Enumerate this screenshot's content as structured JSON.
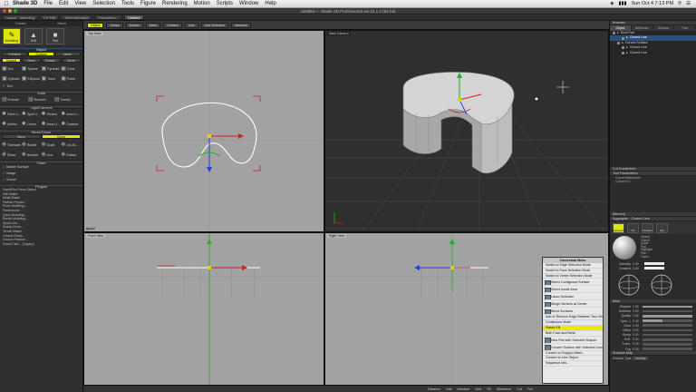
{
  "menubar": {
    "app": "Shade 3D",
    "items": [
      "File",
      "Edit",
      "View",
      "Selection",
      "Tools",
      "Figure",
      "Rendering",
      "Motion",
      "Scripts",
      "Window",
      "Help"
    ],
    "clock": "Sun Oct 4  7:13 PM"
  },
  "window": {
    "title": "Untitled — Shade 3D Professional ver.15.1.2 (64-bit)"
  },
  "doc_tabs": [
    "Layout - Modeling",
    "UV Edit",
    "Shot Animation",
    "Parametric...",
    "Untitled"
  ],
  "left_panel": {
    "tabs": [
      "Create",
      "Mesh"
    ],
    "tools": [
      {
        "label": "Modeling",
        "icon": "modeling-icon"
      },
      {
        "label": "Edit",
        "icon": "edit-icon"
      },
      {
        "label": "Part",
        "icon": "part-icon"
      }
    ],
    "object_header": "Object",
    "mode_buttons": [
      "Primitive",
      "Surface",
      "Mesh"
    ],
    "sub_buttons": [
      "Closed",
      "Open",
      "Rotati...",
      "Circle"
    ],
    "shape_rows": [
      [
        "Box",
        "Sphere",
        "Pyramid",
        "Cone"
      ],
      [
        "Cylinder",
        "Ellipsoid",
        "Torus",
        "Plane"
      ]
    ],
    "text_label": "Text",
    "solid_header": "Solid",
    "solid_buttons": [
      "Extrude",
      "Revolve",
      "Sweep"
    ],
    "light_header": "Light/Camera",
    "light_rows": [
      [
        "Point Li...",
        "Spot Li...",
        "Distant",
        "Area Li..."
      ],
      [
        "Ambie...",
        "Linear",
        "Area Li...",
        "Camera"
      ]
    ],
    "move_header": "Move/Clone",
    "move_buttons": [
      "Move",
      "Clone"
    ],
    "transform_rows": [
      [
        "Translate",
        "Rotate",
        "Scale",
        "Uni-Sc..."
      ],
      [
        "Shear",
        "Number",
        "Line",
        "Flatten"
      ]
    ],
    "other_header": "Other",
    "other_items": [
      "Master Surface",
      "Image",
      "Sound"
    ],
    "plugins_header": "Plugins",
    "plugins": [
      "DepthPlus Focus Object",
      "Hair Maker",
      "Metal Shade",
      "Particle Physics",
      "Photo Modeling...",
      "Preferences",
      "Quick Modeling...",
      "Sketch Modeling...",
      "Spiral Line...",
      "Sweep Circle...",
      "Terrain Maker",
      "Volume Rocks...",
      "Voronoi Fracture...",
      "Forest Falls... (Legacy)"
    ]
  },
  "viewport_toolbar": [
    "Object",
    "Shape",
    "Motion",
    "Mesh",
    "Surface",
    "Line",
    "Line Selection",
    "Measure"
  ],
  "viewports": {
    "top": {
      "label": "Top View"
    },
    "perspective": {
      "label": "Main Camera"
    },
    "front": {
      "label": "Front View"
    },
    "right": {
      "label": "Right View"
    },
    "global_label": "global"
  },
  "context_menu": {
    "title": "Contextual Menu",
    "items": [
      {
        "label": "Switch to Edge Selection Mode",
        "big": false
      },
      {
        "label": "Switch to Face Selection Mode",
        "big": false
      },
      {
        "label": "Switch to Vertex Selection Mode",
        "big": false
      },
      {
        "label": "Select Contiguous Surface",
        "big": true
      },
      {
        "label": "Select Inside Area",
        "big": true
      },
      {
        "label": "Lasso Selection",
        "big": true
      },
      {
        "label": "Merge Vertices at Center",
        "big": true
      },
      {
        "label": "Mend Surfaces",
        "big": true
      },
      {
        "label": "Add or Remove Edge Between Two Vertices",
        "big": false
      },
      {
        "label": "Continuous Mode",
        "big": false
      },
      {
        "label": "Plastic Fill",
        "big": false,
        "highlight": true
      },
      {
        "label": "Both Face and Mesh",
        "big": false
      },
      {
        "label": "New Part with Selected Shapes",
        "big": true
      },
      {
        "label": "Convert Surface with Selected Lines",
        "big": true
      },
      {
        "label": "Convert to Polygon Mesh...",
        "big": false
      },
      {
        "label": "Convert to Line Object",
        "big": false
      },
      {
        "label": "Sequence Info...",
        "big": false
      }
    ]
  },
  "status_bar": [
    "Distance",
    "Unit",
    "Absolute",
    "Grid",
    "Fill",
    "Wireframe",
    "Cut",
    "Full"
  ],
  "right_panel": {
    "browser_title": "Browser",
    "browser_tabs": [
      "Object",
      "Attributes",
      "Shadow",
      "Part"
    ],
    "tree": [
      {
        "label": "Root Part",
        "indent": 0,
        "sel": false
      },
      {
        "label": "Closed Line",
        "indent": 2,
        "sel": true
      },
      {
        "label": "Curved Surface",
        "indent": 1,
        "sel": false
      },
      {
        "label": "Closed Line",
        "indent": 2,
        "sel": false
      },
      {
        "label": "Closed Line",
        "indent": 2,
        "sel": false
      }
    ],
    "selected_count": "1 of 5 selected",
    "tool_params_header": "Tool Parameters",
    "tool_params": [
      "Convert/Memorize",
      "Convert To"
    ],
    "memory_header": "Memory",
    "surface_header": "Aggregate : Closed Line",
    "material_tabs": [
      "Aggregate",
      "Fill",
      "Surface",
      "Info"
    ],
    "preview_props": [
      "Global",
      "Object",
      "Quad",
      "Flat",
      "Highlight",
      "Refl...",
      "Trans..."
    ],
    "color_rows": [
      {
        "label": "Intensity",
        "value": "1.00"
      },
      {
        "label": "Ambient",
        "value": "0.00"
      }
    ],
    "misc_header": "Misc",
    "sliders": [
      {
        "label": "Shadow",
        "value": "1.00",
        "fill": 1.0
      },
      {
        "label": "Softness",
        "value": "0.00",
        "fill": 0.0
      },
      {
        "label": "Quality",
        "value": "1.00",
        "fill": 1.0
      },
      {
        "label": "Spec. 1",
        "value": "0.40",
        "fill": 0.4
      },
      {
        "label": "Glow",
        "value": "0.00",
        "fill": 0.0
      },
      {
        "label": "Offset",
        "value": "0.00",
        "fill": 0.0
      },
      {
        "label": "Bump",
        "value": "0.00",
        "fill": 0.0
      },
      {
        "label": "Refl.",
        "value": "0.00",
        "fill": 0.0
      },
      {
        "label": "Trans.",
        "value": "0.00",
        "fill": 0.0
      },
      {
        "label": "Fog",
        "value": "0.00",
        "fill": 0.0
      }
    ],
    "shadow_map": "Shadow Map",
    "shadow_type_label": "Shadow Type",
    "shadow_type_value": "Normal"
  },
  "colors": {
    "accent_yellow": "#e0e800",
    "selection_blue": "#2d4f7d",
    "x_axis": "#d02020",
    "y_axis": "#20b020",
    "z_axis": "#2040e0"
  }
}
